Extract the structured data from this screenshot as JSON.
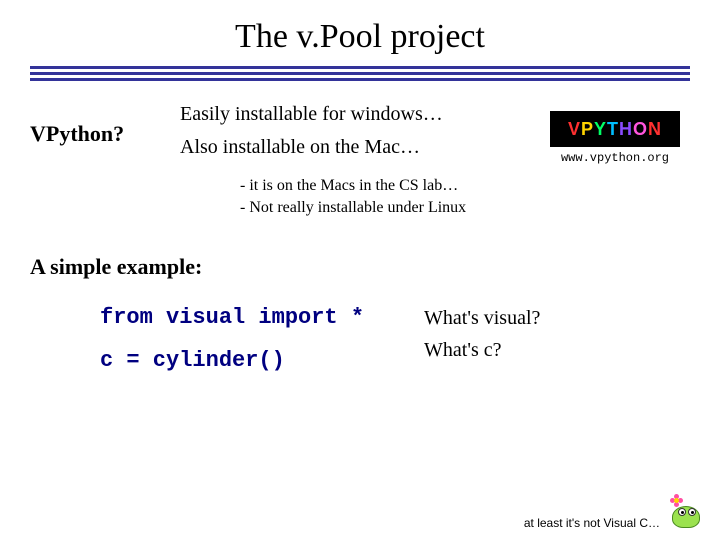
{
  "title": "The v.Pool project",
  "left_heading": "VPython?",
  "install_lines": [
    "Easily installable for windows…",
    "Also installable on the Mac…"
  ],
  "logo_text": "VPYTHON",
  "url": "www.vpython.org",
  "notes": [
    "- it is on the Macs in the CS lab…",
    "- Not really installable under Linux"
  ],
  "example_heading": "A simple example:",
  "code_lines": [
    "from visual import *",
    "c = cylinder()"
  ],
  "questions": [
    "What's visual?",
    "What's c?"
  ],
  "footer": "at least it's not Visual C…"
}
